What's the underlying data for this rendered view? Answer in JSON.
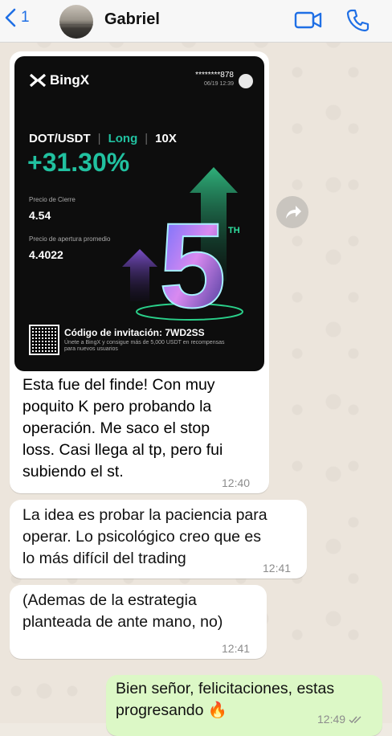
{
  "header": {
    "back_count": "1",
    "contact_name": "Gabriel"
  },
  "card": {
    "brand": "BingX",
    "username": "********878",
    "date": "06/19 12:39",
    "pair": "DOT/USDT",
    "direction": "Long",
    "leverage": "10X",
    "pnl_percent": "+31.30%",
    "close_price_label": "Precio de Cierre",
    "close_price": "4.54",
    "avg_open_label": "Precio de apertura promedio",
    "avg_open": "4.4022",
    "anniversary_number": "5",
    "anniversary_suffix": "TH",
    "invite_label": "Código de invitación: 7WD2SS",
    "invite_sub": "Únete a BingX y consigue más de 5,000 USDT en recompensas para nuevos usuarios"
  },
  "messages": [
    {
      "text_lines": [
        "Esta fue del finde! Con muy",
        "poquito  K pero probando la",
        "operación. Me saco el stop",
        "loss. Casi llega al tp, pero fui",
        "subiendo el st."
      ],
      "time": "12:40",
      "direction": "in"
    },
    {
      "text_lines": [
        "La idea es probar la paciencia para",
        "operar. Lo psicológico creo que es",
        "lo más difícil del trading"
      ],
      "time": "12:41",
      "direction": "in"
    },
    {
      "text_lines": [
        "(Ademas de la estrategia",
        "planteada de ante mano, no)"
      ],
      "time": "12:41",
      "direction": "in"
    },
    {
      "text_lines": [
        "Bien señor, felicitaciones, estas",
        "progresando 🔥"
      ],
      "time": "12:49",
      "direction": "out",
      "status": "read"
    }
  ],
  "colors": {
    "accent": "#1f6fe5",
    "profit": "#21c1a0",
    "outgoing_bubble": "#dcf8c6"
  }
}
